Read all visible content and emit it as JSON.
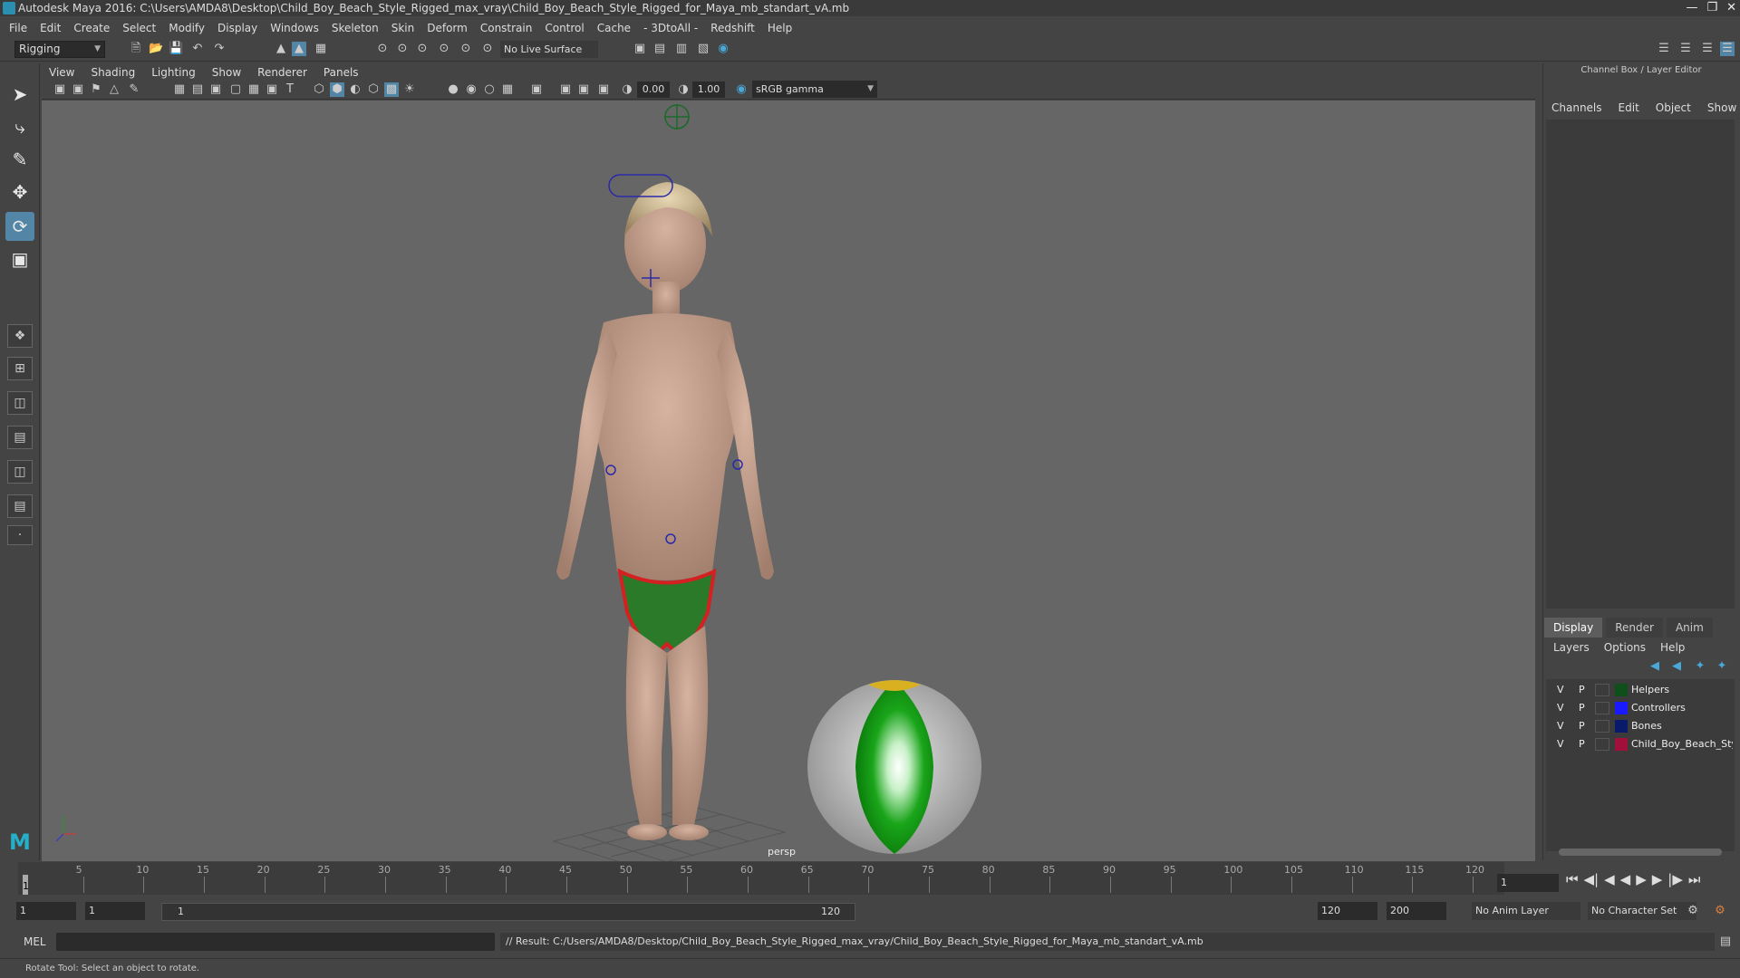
{
  "window": {
    "title": "Autodesk Maya 2016: C:\\Users\\AMDA8\\Desktop\\Child_Boy_Beach_Style_Rigged_max_vray\\Child_Boy_Beach_Style_Rigged_for_Maya_mb_standart_vA.mb"
  },
  "menubar": [
    "File",
    "Edit",
    "Create",
    "Select",
    "Modify",
    "Display",
    "Windows",
    "Skeleton",
    "Skin",
    "Deform",
    "Constrain",
    "Control",
    "Cache",
    "- 3DtoAll -",
    "Redshift",
    "Help"
  ],
  "toolbar": {
    "mode": "Rigging",
    "live_surface": "No Live Surface"
  },
  "panel": {
    "menu": [
      "View",
      "Shading",
      "Lighting",
      "Show",
      "Renderer",
      "Panels"
    ],
    "near_value": "0.00",
    "far_value": "1.00",
    "color_management": "sRGB gamma",
    "camera_label": "persp"
  },
  "channel_box": {
    "title": "Channel Box / Layer Editor",
    "menu": [
      "Channels",
      "Edit",
      "Object",
      "Show"
    ]
  },
  "layer_editor": {
    "tabs": [
      "Display",
      "Render",
      "Anim"
    ],
    "active_tab": "Display",
    "menu": [
      "Layers",
      "Options",
      "Help"
    ],
    "layers": [
      {
        "v": "V",
        "p": "P",
        "name": "Helpers",
        "color": "#0f4f1c"
      },
      {
        "v": "V",
        "p": "P",
        "name": "Controllers",
        "color": "#1a1aff"
      },
      {
        "v": "V",
        "p": "P",
        "name": "Bones",
        "color": "#0a1a6a"
      },
      {
        "v": "V",
        "p": "P",
        "name": "Child_Boy_Beach_Style",
        "color": "#a0103a"
      }
    ]
  },
  "timeline": {
    "ticks": [
      "5",
      "10",
      "15",
      "20",
      "25",
      "30",
      "35",
      "40",
      "45",
      "50",
      "55",
      "60",
      "65",
      "70",
      "75",
      "80",
      "85",
      "90",
      "95",
      "100",
      "105",
      "110",
      "115",
      "120"
    ],
    "playhead": "1",
    "current_frame": "1"
  },
  "range": {
    "start": "1",
    "playback_start": "1",
    "slider_start": "1",
    "slider_end": "120",
    "playback_end": "120",
    "end": "200",
    "anim_layer": "No Anim Layer",
    "character_set": "No Character Set"
  },
  "command_line": {
    "label": "MEL",
    "result": "// Result: C:/Users/AMDA8/Desktop/Child_Boy_Beach_Style_Rigged_max_vray/Child_Boy_Beach_Style_Rigged_for_Maya_mb_standart_vA.mb"
  },
  "help_line": "Rotate Tool: Select an object to rotate."
}
